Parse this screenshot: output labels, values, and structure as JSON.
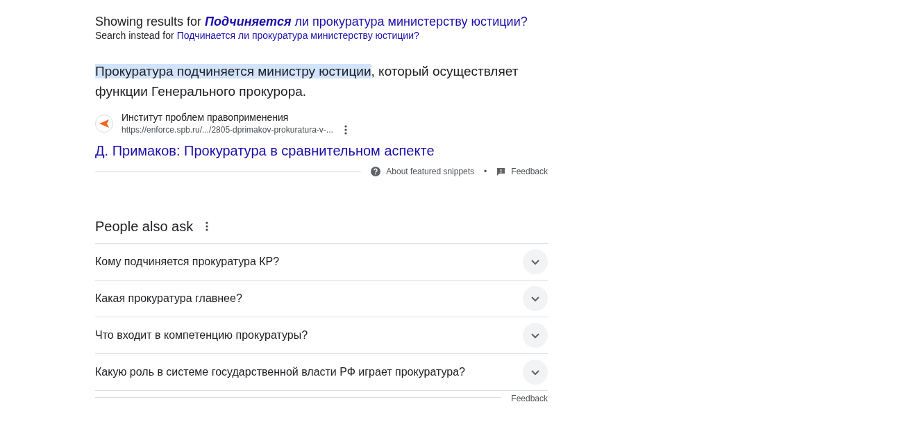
{
  "correction": {
    "prefix": "Showing results for",
    "corrected": "**Подчиняется** ли прокуратура министерству юстиции?",
    "instead_prefix": "Search instead for",
    "original": "Подчинается ли прокуратура министерству юстиции?"
  },
  "snippet": {
    "highlighted": "Прокуратура подчиняется министру юстиции",
    "text": ", который осуществляет функции Генерального прокурора.",
    "source_name": "Институт проблем правоприменения",
    "url": "https://enforce.spb.ru/.../2805-dprimakov-prokuratura-v-...",
    "title": "Д. Примаков: Прокуратура в сравнительном аспекте",
    "about": "About featured snippets",
    "separator": "•",
    "feedback": "Feedback"
  },
  "people_also_ask": {
    "title": "People also ask",
    "questions": [
      {
        "text": "Кому подчиняется прокуратура КР?",
        "expanded": false
      },
      {
        "text": "Какая прокуратура главнее?",
        "expanded": false
      },
      {
        "text": "Что входит в компетенцию прокуратуры?",
        "expanded": false
      },
      {
        "text": "Какую роль в системе государственной власти РФ играет прокуратура?",
        "expanded": false
      }
    ],
    "feedback": "Feedback"
  }
}
